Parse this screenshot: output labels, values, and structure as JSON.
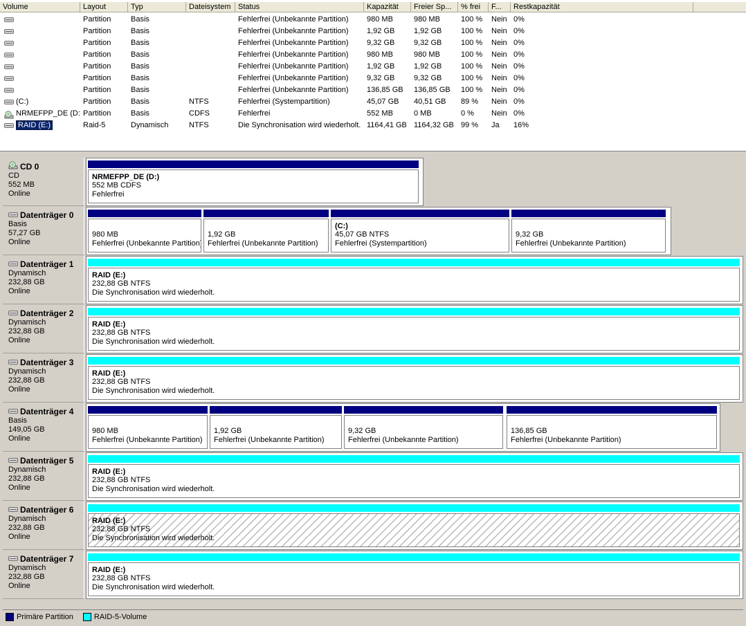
{
  "colors": {
    "primary": "#000080",
    "raid5": "#00ffff"
  },
  "columns": [
    "Volume",
    "Layout",
    "Typ",
    "Dateisystem",
    "Status",
    "Kapazität",
    "Freier Sp...",
    "% frei",
    "F...",
    "Restkapazität"
  ],
  "volumes": [
    {
      "name": "",
      "icon": "disk-icon",
      "layout": "Partition",
      "type": "Basis",
      "fs": "",
      "status": "Fehlerfrei (Unbekannte Partition)",
      "capacity": "980 MB",
      "free": "980 MB",
      "pct": "100 %",
      "ft": "Nein",
      "rest": "0%"
    },
    {
      "name": "",
      "icon": "disk-icon",
      "layout": "Partition",
      "type": "Basis",
      "fs": "",
      "status": "Fehlerfrei (Unbekannte Partition)",
      "capacity": "1,92 GB",
      "free": "1,92 GB",
      "pct": "100 %",
      "ft": "Nein",
      "rest": "0%"
    },
    {
      "name": "",
      "icon": "disk-icon",
      "layout": "Partition",
      "type": "Basis",
      "fs": "",
      "status": "Fehlerfrei (Unbekannte Partition)",
      "capacity": "9,32 GB",
      "free": "9,32 GB",
      "pct": "100 %",
      "ft": "Nein",
      "rest": "0%"
    },
    {
      "name": "",
      "icon": "disk-icon",
      "layout": "Partition",
      "type": "Basis",
      "fs": "",
      "status": "Fehlerfrei (Unbekannte Partition)",
      "capacity": "980 MB",
      "free": "980 MB",
      "pct": "100 %",
      "ft": "Nein",
      "rest": "0%"
    },
    {
      "name": "",
      "icon": "disk-icon",
      "layout": "Partition",
      "type": "Basis",
      "fs": "",
      "status": "Fehlerfrei (Unbekannte Partition)",
      "capacity": "1,92 GB",
      "free": "1,92 GB",
      "pct": "100 %",
      "ft": "Nein",
      "rest": "0%"
    },
    {
      "name": "",
      "icon": "disk-icon",
      "layout": "Partition",
      "type": "Basis",
      "fs": "",
      "status": "Fehlerfrei (Unbekannte Partition)",
      "capacity": "9,32 GB",
      "free": "9,32 GB",
      "pct": "100 %",
      "ft": "Nein",
      "rest": "0%"
    },
    {
      "name": "",
      "icon": "disk-icon",
      "layout": "Partition",
      "type": "Basis",
      "fs": "",
      "status": "Fehlerfrei (Unbekannte Partition)",
      "capacity": "136,85 GB",
      "free": "136,85 GB",
      "pct": "100 %",
      "ft": "Nein",
      "rest": "0%"
    },
    {
      "name": "(C:)",
      "icon": "disk-icon",
      "layout": "Partition",
      "type": "Basis",
      "fs": "NTFS",
      "status": "Fehlerfrei (Systempartition)",
      "capacity": "45,07 GB",
      "free": "40,51 GB",
      "pct": "89 %",
      "ft": "Nein",
      "rest": "0%"
    },
    {
      "name": "NRMEFPP_DE (D:)",
      "icon": "cd-icon",
      "layout": "Partition",
      "type": "Basis",
      "fs": "CDFS",
      "status": "Fehlerfrei",
      "capacity": "552 MB",
      "free": "0 MB",
      "pct": "0 %",
      "ft": "Nein",
      "rest": "0%"
    },
    {
      "name": "RAID (E:)",
      "icon": "disk-icon",
      "layout": "Raid-5",
      "type": "Dynamisch",
      "fs": "NTFS",
      "status": "Die Synchronisation wird wiederholt.",
      "capacity": "1164,41 GB",
      "free": "1164,32 GB",
      "pct": "99 %",
      "ft": "Ja",
      "rest": "16%",
      "selected": true
    }
  ],
  "disks": [
    {
      "title": "CD 0",
      "icon": "cd-icon",
      "type": "CD",
      "size": "552 MB",
      "state": "Online",
      "parts": [
        {
          "name": "NRMEFPP_DE  (D:)",
          "l1": "552 MB CDFS",
          "l2": "Fehlerfrei",
          "kind": "primary"
        }
      ]
    },
    {
      "title": "Datenträger 0",
      "icon": "disk-icon",
      "type": "Basis",
      "size": "57,27 GB",
      "state": "Online",
      "parts": [
        {
          "name": "",
          "l1": "980 MB",
          "l2": "Fehlerfrei (Unbekannte Partition)",
          "kind": "primary"
        },
        {
          "name": "",
          "l1": "1,92 GB",
          "l2": "Fehlerfrei (Unbekannte Partition)",
          "kind": "primary"
        },
        {
          "name": "(C:)",
          "l1": "45,07 GB NTFS",
          "l2": "Fehlerfrei (Systempartition)",
          "kind": "primary"
        },
        {
          "name": "",
          "l1": "9,32 GB",
          "l2": "Fehlerfrei (Unbekannte Partition)",
          "kind": "primary"
        }
      ]
    },
    {
      "title": "Datenträger 1",
      "icon": "disk-icon",
      "type": "Dynamisch",
      "size": "232,88 GB",
      "state": "Online",
      "parts": [
        {
          "name": "RAID  (E:)",
          "l1": "232,88 GB NTFS",
          "l2": "Die Synchronisation wird wiederholt.",
          "kind": "raid5"
        }
      ]
    },
    {
      "title": "Datenträger 2",
      "icon": "disk-icon",
      "type": "Dynamisch",
      "size": "232,88 GB",
      "state": "Online",
      "parts": [
        {
          "name": "RAID  (E:)",
          "l1": "232,88 GB NTFS",
          "l2": "Die Synchronisation wird wiederholt.",
          "kind": "raid5"
        }
      ]
    },
    {
      "title": "Datenträger 3",
      "icon": "disk-icon",
      "type": "Dynamisch",
      "size": "232,88 GB",
      "state": "Online",
      "parts": [
        {
          "name": "RAID  (E:)",
          "l1": "232,88 GB NTFS",
          "l2": "Die Synchronisation wird wiederholt.",
          "kind": "raid5"
        }
      ]
    },
    {
      "title": "Datenträger 4",
      "icon": "disk-icon",
      "type": "Basis",
      "size": "149,05 GB",
      "state": "Online",
      "parts": [
        {
          "name": "",
          "l1": "980 MB",
          "l2": "Fehlerfrei (Unbekannte Partition)",
          "kind": "primary"
        },
        {
          "name": "",
          "l1": "1,92 GB",
          "l2": "Fehlerfrei (Unbekannte Partition)",
          "kind": "primary"
        },
        {
          "name": "",
          "l1": "9,32 GB",
          "l2": "Fehlerfrei (Unbekannte Partition)",
          "kind": "primary"
        },
        {
          "name": "",
          "l1": "136,85 GB",
          "l2": "Fehlerfrei (Unbekannte Partition)",
          "kind": "primary"
        }
      ]
    },
    {
      "title": "Datenträger 5",
      "icon": "disk-icon",
      "type": "Dynamisch",
      "size": "232,88 GB",
      "state": "Online",
      "parts": [
        {
          "name": "RAID  (E:)",
          "l1": "232,88 GB NTFS",
          "l2": "Die Synchronisation wird wiederholt.",
          "kind": "raid5"
        }
      ]
    },
    {
      "title": "Datenträger 6",
      "icon": "disk-icon",
      "type": "Dynamisch",
      "size": "232,88 GB",
      "state": "Online",
      "parts": [
        {
          "name": "RAID  (E:)",
          "l1": "232,88 GB NTFS",
          "l2": "Die Synchronisation wird wiederholt.",
          "kind": "raid5",
          "selected": true
        }
      ]
    },
    {
      "title": "Datenträger 7",
      "icon": "disk-icon",
      "type": "Dynamisch",
      "size": "232,88 GB",
      "state": "Online",
      "parts": [
        {
          "name": "RAID  (E:)",
          "l1": "232,88 GB NTFS",
          "l2": "Die Synchronisation wird wiederholt.",
          "kind": "raid5"
        }
      ]
    }
  ],
  "legend": [
    {
      "label": "Primäre Partition",
      "color": "#000080"
    },
    {
      "label": "RAID-5-Volume",
      "color": "#00ffff"
    }
  ]
}
